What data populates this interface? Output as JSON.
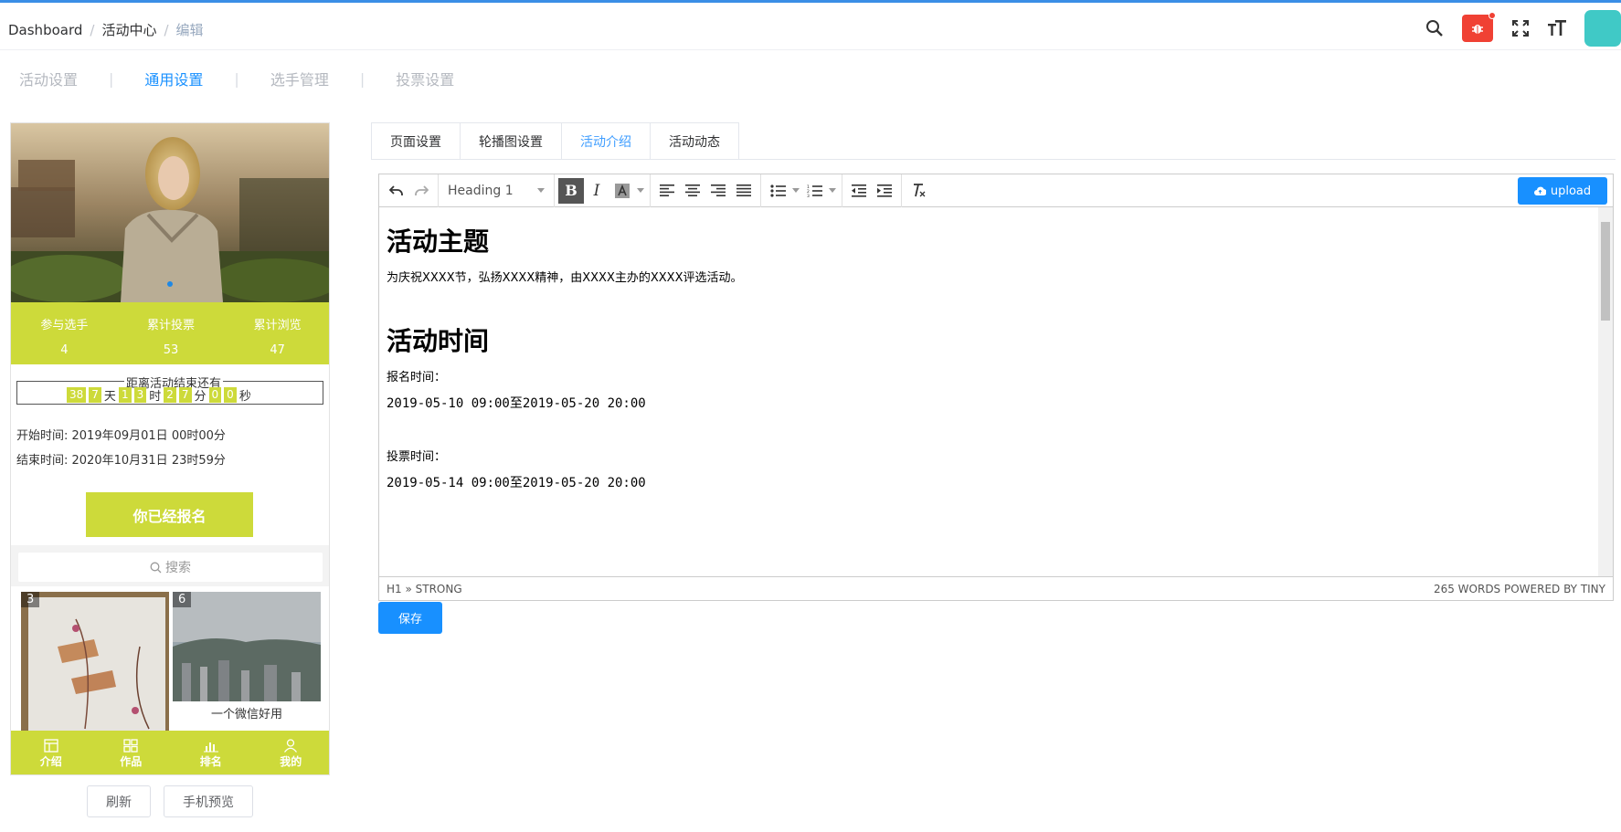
{
  "breadcrumb": {
    "items": [
      "Dashboard",
      "活动中心",
      "编辑"
    ],
    "sep": "/"
  },
  "colors": {
    "accent": "#1890ff",
    "phone_theme": "#cdda3a",
    "bug": "#f04134",
    "avatar": "#40c9c6"
  },
  "subtabs": [
    "活动设置",
    "通用设置",
    "选手管理",
    "投票设置"
  ],
  "subtabs_active": "通用设置",
  "phone": {
    "stats": [
      {
        "label": "参与选手",
        "value": "4"
      },
      {
        "label": "累计投票",
        "value": "53"
      },
      {
        "label": "累计浏览",
        "value": "47"
      }
    ],
    "countdown": {
      "title": "距离活动结束还有",
      "days": [
        "38",
        "7"
      ],
      "day_unit": "天",
      "hours": [
        "1",
        "3"
      ],
      "hour_unit": "时",
      "minutes": [
        "2",
        "7"
      ],
      "minute_unit": "分",
      "seconds": [
        "0",
        "0"
      ],
      "second_unit": "秒"
    },
    "start_time": "开始时间: 2019年09月01日 00时00分",
    "end_time": "结束时间: 2020年10月31日 23时59分",
    "signed_button": "你已经报名",
    "search_placeholder": "搜索",
    "cards": [
      {
        "num": "3",
        "caption": ""
      },
      {
        "num": "6",
        "caption": "一个微信好用"
      }
    ],
    "bottom_nav": [
      "介绍",
      "作品",
      "排名",
      "我的"
    ]
  },
  "phone_buttons": {
    "refresh": "刷新",
    "preview": "手机预览"
  },
  "editor_tabs": [
    "页面设置",
    "轮播图设置",
    "活动介绍",
    "活动动态"
  ],
  "editor_tab_active": "活动介绍",
  "toolbar": {
    "format": "Heading 1",
    "upload": "upload",
    "bold": "B",
    "italic": "I"
  },
  "content": {
    "h1_a": "活动主题",
    "p_a": "为庆祝XXXX节，弘扬XXXX精神，由XXXX主办的XXXX评选活动。",
    "h1_b": "活动时间",
    "signup_label": "报名时间：",
    "signup_range": "2019-05-10 09:00至2019-05-20 20:00",
    "vote_label": "投票时间：",
    "vote_range": "2019-05-14 09:00至2019-05-20 20:00"
  },
  "statusbar": {
    "path": "H1 » STRONG",
    "words": "265 WORDS POWERED BY TINY"
  },
  "save_button": "保存"
}
